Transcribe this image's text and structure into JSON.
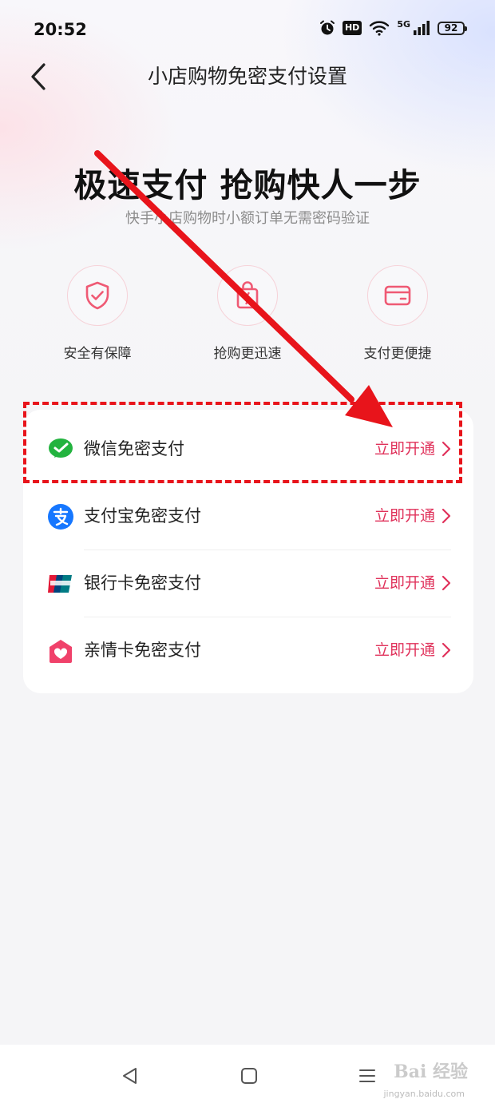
{
  "status_bar": {
    "time": "20:52",
    "hd": "HD",
    "network": "5G",
    "battery": "92"
  },
  "header": {
    "title": "小店购物免密支付设置"
  },
  "hero": {
    "title": "极速支付  抢购快人一步",
    "subtitle": "快手小店购物时小额订单无需密码验证"
  },
  "features": [
    {
      "icon": "shield-check-icon",
      "label": "安全有保障"
    },
    {
      "icon": "shopping-bag-icon",
      "label": "抢购更迅速"
    },
    {
      "icon": "card-icon",
      "label": "支付更便捷"
    }
  ],
  "payment_methods": [
    {
      "icon": "wechat-icon",
      "label": "微信免密支付",
      "action": "立即开通"
    },
    {
      "icon": "alipay-icon",
      "label": "支付宝免密支付",
      "action": "立即开通"
    },
    {
      "icon": "unionpay-icon",
      "label": "银行卡免密支付",
      "action": "立即开通"
    },
    {
      "icon": "family-card-icon",
      "label": "亲情卡免密支付",
      "action": "立即开通"
    }
  ],
  "watermark": {
    "text": "Bai 经验",
    "url": "jingyan.baidu.com"
  },
  "colors": {
    "accent": "#e0325b",
    "annotation": "#e8141b",
    "wechat": "#23b33f",
    "alipay": "#1677ff"
  }
}
